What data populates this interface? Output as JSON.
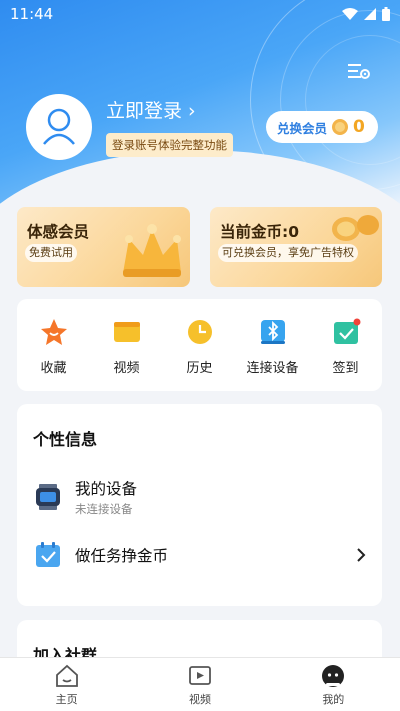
{
  "status_bar": {
    "time": "11:44"
  },
  "profile": {
    "login_text": "立即登录 ›",
    "login_tag": "登录账号体验完整功能",
    "redeem_label": "兑换会员",
    "coin_count": "0"
  },
  "promos": [
    {
      "title": "体感会员",
      "subtitle": "免费试用"
    },
    {
      "title": "当前金币:0",
      "subtitle": "可兑换会员，享免广告特权"
    }
  ],
  "quick_actions": [
    {
      "label": "收藏",
      "icon": "star-icon"
    },
    {
      "label": "视频",
      "icon": "folder-icon"
    },
    {
      "label": "历史",
      "icon": "clock-icon"
    },
    {
      "label": "连接设备",
      "icon": "bluetooth-icon"
    },
    {
      "label": "签到",
      "icon": "checkin-icon"
    }
  ],
  "personal_info": {
    "title": "个性信息",
    "rows": [
      {
        "title": "我的设备",
        "subtitle": "未连接设备"
      },
      {
        "title": "做任务挣金币"
      }
    ]
  },
  "social": {
    "title": "加入社群"
  },
  "bottom_nav": [
    {
      "label": "主页",
      "icon": "home-icon"
    },
    {
      "label": "视频",
      "icon": "video-icon"
    },
    {
      "label": "我的",
      "icon": "profile-icon",
      "active": true
    }
  ],
  "colors": {
    "primary": "#2f8cf0",
    "gold": "#f3a623",
    "tag_bg": "#fdeccb"
  }
}
